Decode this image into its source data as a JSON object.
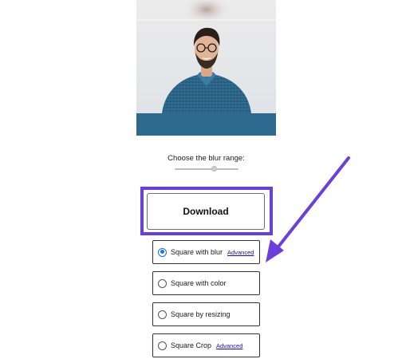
{
  "blur": {
    "label": "Choose the blur range:",
    "value": 0.62
  },
  "download": {
    "label": "Download"
  },
  "options": [
    {
      "label": "Square with blur",
      "checked": true,
      "link": "Advanced"
    },
    {
      "label": "Square with color",
      "checked": false,
      "link": ""
    },
    {
      "label": "Square by resizing",
      "checked": false,
      "link": ""
    },
    {
      "label": "Square Crop",
      "checked": false,
      "link": "Advanced"
    }
  ],
  "colors": {
    "highlight": "#6b3fd9",
    "arrow": "#6b3fd9",
    "radio_checked": "#1a73e8",
    "link": "#1a0dab",
    "shirt": "#2f6f92"
  }
}
